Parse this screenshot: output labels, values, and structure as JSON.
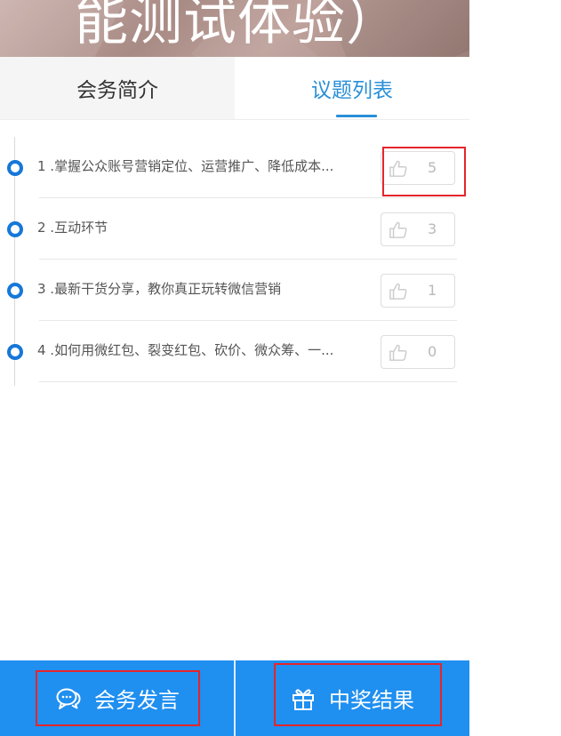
{
  "banner": {
    "title": "能测试体验）"
  },
  "tabs": [
    {
      "label": "会务简介",
      "active": false
    },
    {
      "label": "议题列表",
      "active": true
    }
  ],
  "topics": [
    {
      "index": "1",
      "title": "1 .掌握公众账号营销定位、运营推广、降低成本...",
      "likes": "5"
    },
    {
      "index": "2",
      "title": "2 .互动环节",
      "likes": "3"
    },
    {
      "index": "3",
      "title": "3 .最新干货分享，教你真正玩转微信营销",
      "likes": "1"
    },
    {
      "index": "4",
      "title": "4 .如何用微红包、裂变红包、砍价、微众筹、一...",
      "likes": "0"
    }
  ],
  "bottom_bar": {
    "speech_label": "会务发言",
    "speech_icon": "chat-bubbles-icon",
    "prize_label": "中奖结果",
    "prize_icon": "gift-icon"
  },
  "colors": {
    "accent": "#2a8fd8",
    "bar_blue": "#1f8ff0",
    "timeline_dot": "#1677d9",
    "highlight_red": "#e5252a"
  }
}
